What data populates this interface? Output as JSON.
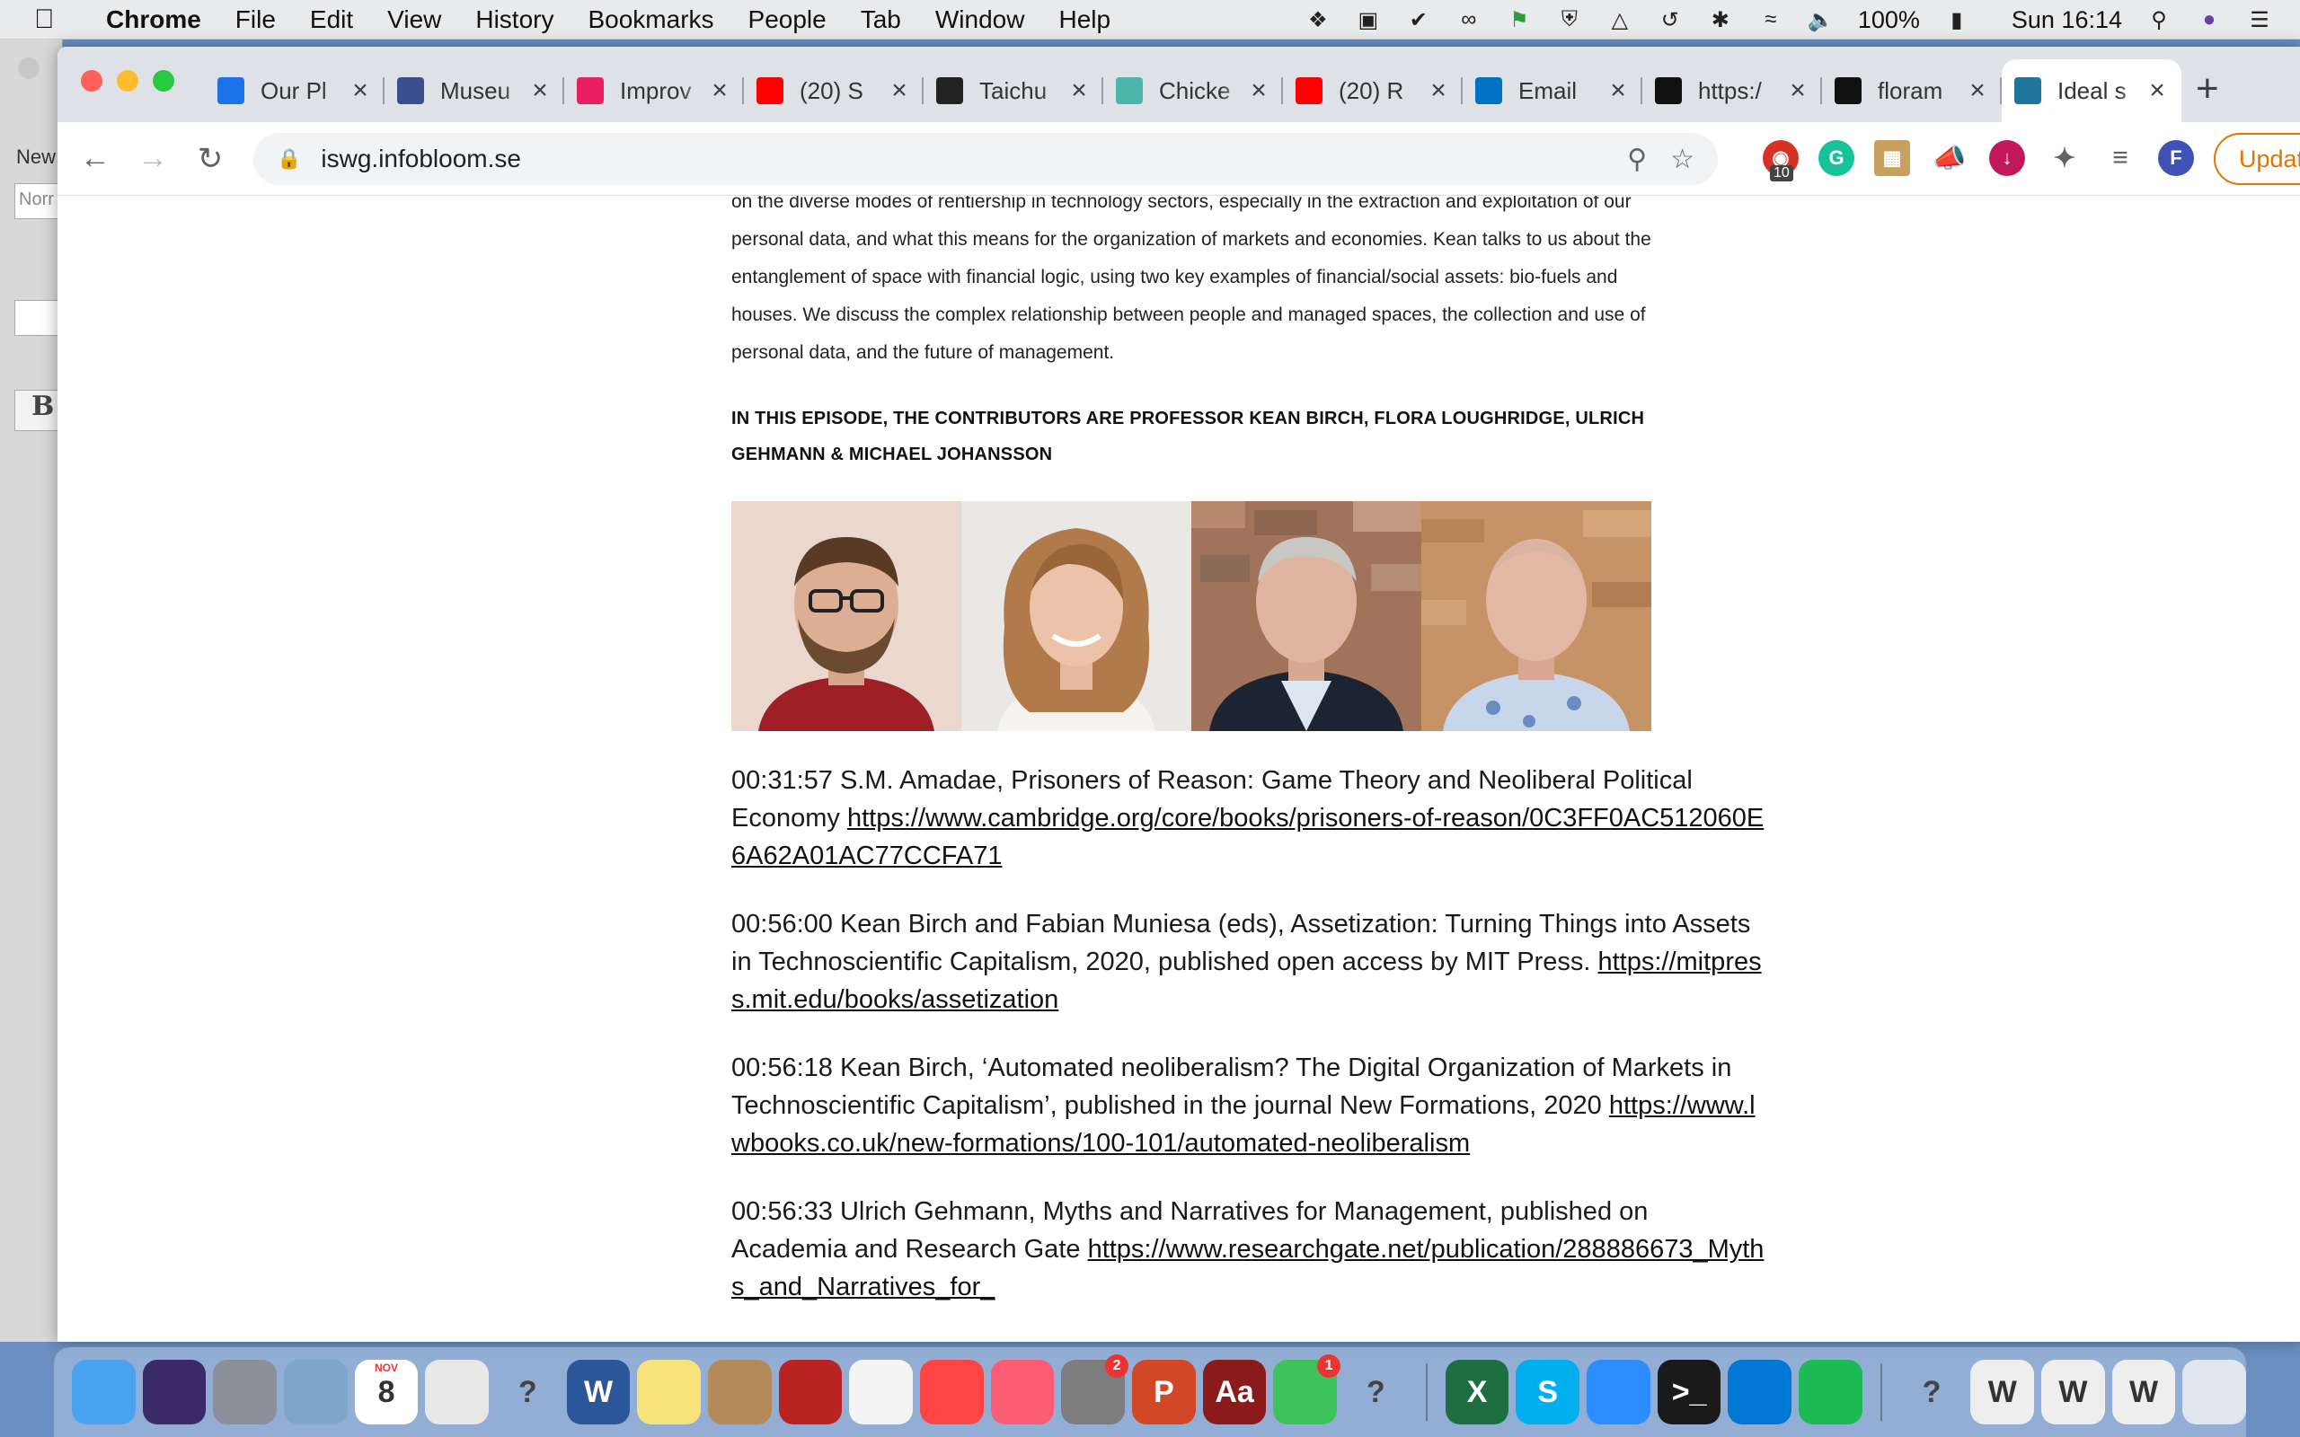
{
  "menubar": {
    "app_name": "Chrome",
    "items": [
      "File",
      "Edit",
      "View",
      "History",
      "Bookmarks",
      "People",
      "Tab",
      "Window",
      "Help"
    ],
    "battery": "100%",
    "clock": "Sun 16:14"
  },
  "background_app": {
    "new_label": "New",
    "style_field": "Norr",
    "bold_button": "B"
  },
  "tabs": [
    {
      "title": "Our Pl",
      "favicon_color": "#1a73e8",
      "favicon": "search-globe-icon"
    },
    {
      "title": "Museu",
      "favicon_color": "#3b4f8f",
      "favicon": "museum-icon"
    },
    {
      "title": "Improv",
      "favicon_color": "#e91e63",
      "favicon": "sparkle-icon"
    },
    {
      "title": "(20) S",
      "favicon_color": "#ff0000",
      "favicon": "youtube-icon"
    },
    {
      "title": "Taichu",
      "favicon_color": "#222222",
      "favicon": "letter-a-icon"
    },
    {
      "title": "Chicke",
      "favicon_color": "#4db6ac",
      "favicon": "jo-icon"
    },
    {
      "title": "(20) R",
      "favicon_color": "#ff0000",
      "favicon": "youtube-icon"
    },
    {
      "title": "Email",
      "favicon_color": "#0072c6",
      "favicon": "outlook-icon"
    },
    {
      "title": "https:/",
      "favicon_color": "#111111",
      "favicon": "fl-icon"
    },
    {
      "title": "floram",
      "favicon_color": "#111111",
      "favicon": "github-icon"
    },
    {
      "title": "Ideal s",
      "favicon_color": "#21759b",
      "favicon": "wordpress-icon",
      "active": true
    }
  ],
  "toolbar": {
    "url": "iswg.infobloom.se",
    "update_label": "Update",
    "extension_badge": "10",
    "profile_initial": "F"
  },
  "article": {
    "intro_lines": [
      "on the diverse modes of rentiership in technology sectors, especially in the extraction and exploitation of our",
      "personal data, and what this means for the organization of markets and economies. Kean talks to us about the",
      "entanglement of space with financial logic, using two key examples of financial/social assets: bio-fuels and",
      "houses. We discuss the complex relationship between people and managed spaces, the collection and use of",
      "personal data, and the future of management."
    ],
    "contributors": "IN THIS EPISODE, THE CONTRIBUTORS ARE PROFESSOR KEAN BIRCH, FLORA LOUGHRIDGE, ULRICH GEHMANN & MICHAEL JOHANSSON",
    "references": [
      {
        "text": "00:31:57 S.M. Amadae, Prisoners of Reason: Game Theory and Neoliberal Political Economy ",
        "link": "https://www.cambridge.org/core/books/prisoners-of-reason/0C3FF0AC512060E6A62A01AC77CCFA71"
      },
      {
        "text": "00:56:00 Kean Birch and Fabian Muniesa (eds), Assetization: Turning Things into Assets in Technoscientific Capitalism, 2020, published open access by MIT Press. ",
        "link": "https://mitpress.mit.edu/books/assetization"
      },
      {
        "text": "00:56:18 Kean Birch, ‘Automated neoliberalism? The Digital Organization of Markets in Technoscientific Capitalism’, published in the journal New Formations, 2020 ",
        "link": "https://www.lwbooks.co.uk/new-formations/100-101/automated-neoliberalism"
      },
      {
        "text": "00:56:33 Ulrich Gehmann, Myths and Narratives for Management, published on Academia and Research Gate ",
        "link": "https://www.researchgate.net/publication/288886673_Myths_and_Narratives_for_"
      }
    ]
  },
  "dock": {
    "apps": [
      {
        "name": "finder-icon",
        "color": "#4aa3f0"
      },
      {
        "name": "siri-icon",
        "color": "#3a2a6a"
      },
      {
        "name": "launchpad-icon",
        "color": "#8a8f99"
      },
      {
        "name": "preview-icon",
        "color": "#7ea6c9"
      },
      {
        "name": "calendar-icon",
        "color": "#ffffff",
        "label": "8",
        "sublabel": "NOV"
      },
      {
        "name": "chrome-icon",
        "color": "#e8e8e8"
      },
      {
        "name": "unknown-app-icon",
        "color": "transparent",
        "label": "?"
      },
      {
        "name": "word-icon",
        "color": "#2b579a",
        "label": "W"
      },
      {
        "name": "notes-icon",
        "color": "#f7e27a"
      },
      {
        "name": "contacts-icon",
        "color": "#b58a5a"
      },
      {
        "name": "photo-booth-icon",
        "color": "#b22"
      },
      {
        "name": "photos-icon",
        "color": "#f4f4f4"
      },
      {
        "name": "news-icon",
        "color": "#f44"
      },
      {
        "name": "music-icon",
        "color": "#fb5c74"
      },
      {
        "name": "system-preferences-icon",
        "color": "#7d7d7d",
        "badge": "2"
      },
      {
        "name": "powerpoint-icon",
        "color": "#d24726",
        "label": "P"
      },
      {
        "name": "dictionary-icon",
        "color": "#8b1a1a",
        "label": "Aa"
      },
      {
        "name": "facetime-icon",
        "color": "#3cc35a",
        "badge": "1"
      },
      {
        "name": "unknown-app-icon",
        "color": "transparent",
        "label": "?"
      },
      {
        "name": "excel-icon",
        "color": "#1d6f42",
        "label": "X"
      },
      {
        "name": "skype-icon",
        "color": "#00aff0",
        "label": "S"
      },
      {
        "name": "zoom-icon",
        "color": "#2d8cff"
      },
      {
        "name": "terminal-icon",
        "color": "#1a1a1a",
        "label": ">_"
      },
      {
        "name": "vscode-icon",
        "color": "#0078d4"
      },
      {
        "name": "spotify-icon",
        "color": "#1db954"
      },
      {
        "name": "unknown-app-icon",
        "color": "transparent",
        "label": "?"
      },
      {
        "name": "document-thumbnail-icon",
        "color": "#eeeeee",
        "label": "W"
      },
      {
        "name": "document-thumbnail-icon",
        "color": "#eeeeee",
        "label": "W"
      },
      {
        "name": "document-thumbnail-icon",
        "color": "#eeeeee",
        "label": "W"
      },
      {
        "name": "trash-icon",
        "color": "#dfe6ee"
      }
    ]
  },
  "colors": {
    "tabstrip": "#dee1e6",
    "update_orange": "#e37400",
    "link": "#111111"
  }
}
